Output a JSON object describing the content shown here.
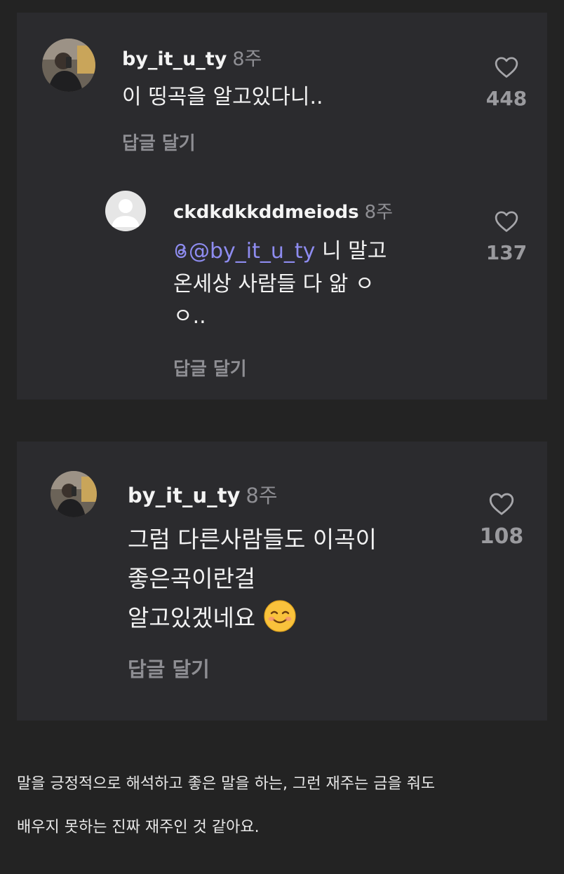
{
  "comments": [
    {
      "username": "by_it_u_ty",
      "time": "8주",
      "text_lines": [
        "이 띵곡을 알고있다니.."
      ],
      "reply_label": "답글 달기",
      "likes": "448",
      "avatar": "photo-avatar"
    },
    {
      "username": "ckdkdkkddmeiods",
      "time": "8주",
      "mention": "@by_it_u_ty",
      "text_lines": [
        " 니 말고",
        "온세상 사람들 다 앎 ㅇ",
        "ㅇ.."
      ],
      "reply_label": "답글 달기",
      "likes": "137",
      "avatar": "default-avatar"
    },
    {
      "username": "by_it_u_ty",
      "time": "8주",
      "text_lines": [
        "그럼 다른사람들도 이곡이",
        "좋은곡이란걸",
        "알고있겠네요 "
      ],
      "emoji": "smiling-face-emoji",
      "reply_label": "답글 달기",
      "likes": "108",
      "avatar": "photo-avatar"
    }
  ],
  "caption": {
    "line1": "말을 긍정적으로 해석하고 좋은 말을 하는, 그런 재주는 금을 줘도",
    "line2": "배우지 못하는 진짜 재주인 것 같아요."
  },
  "colors": {
    "background": "#232323",
    "card": "#2b2b2e",
    "muted": "#8e8e93",
    "mention": "#8e8cf0"
  },
  "icons": {
    "like": "heart-outline-icon",
    "mention_prefix": "threads-icon"
  }
}
